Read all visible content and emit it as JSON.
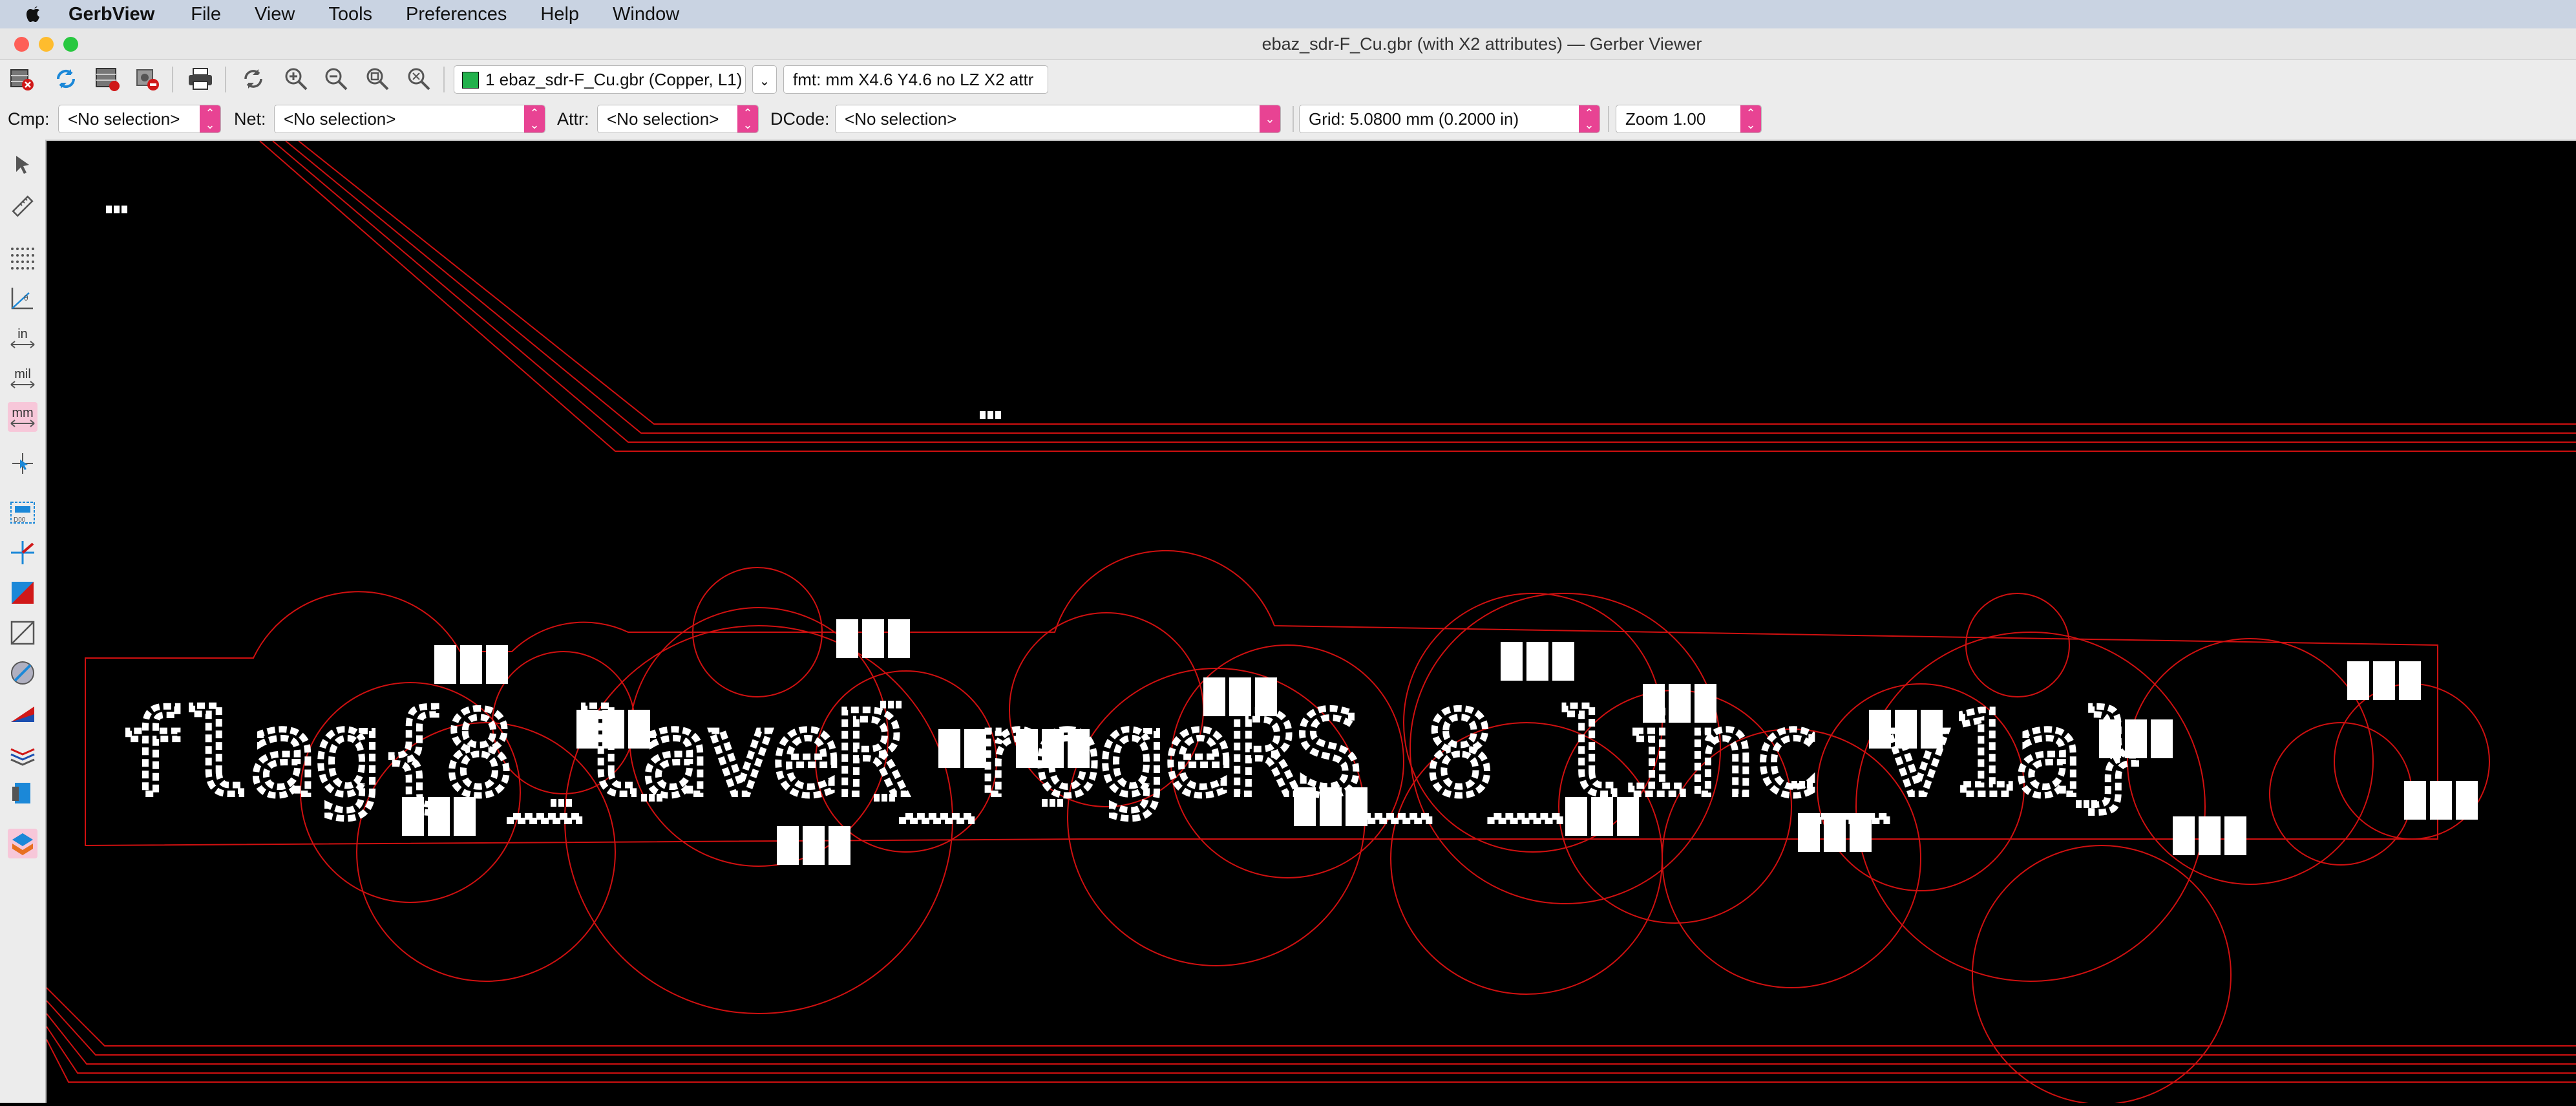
{
  "menubar": {
    "app_name": "GerbView",
    "items": [
      "File",
      "View",
      "Tools",
      "Preferences",
      "Help",
      "Window"
    ]
  },
  "window": {
    "title": "ebaz_sdr-F_Cu.gbr (with X2 attributes) — Gerber Viewer"
  },
  "toolbar": {
    "layer_select": "1 ebaz_sdr-F_Cu.gbr (Copper, L1)",
    "layer_color": "#22b14c",
    "format_info": "fmt: mm X4.6 Y4.6 no LZ X2 attr"
  },
  "filters": {
    "cmp_label": "Cmp:",
    "cmp_value": "<No selection>",
    "net_label": "Net:",
    "net_value": "<No selection>",
    "attr_label": "Attr:",
    "attr_value": "<No selection>",
    "dcode_label": "DCode:",
    "dcode_value": "<No selection>",
    "grid_value": "Grid: 5.0800 mm (0.2000 in)",
    "zoom_value": "Zoom 1.00"
  },
  "left_toolbar": {
    "in_label": "in",
    "mil_label": "mil",
    "mm_label": "mm"
  },
  "canvas": {
    "text_content": "flag{8_laveR_rogeRS_8_linc_v1a}",
    "outline_color": "#d01010",
    "pad_color": "#ffffff",
    "background": "#000000"
  }
}
